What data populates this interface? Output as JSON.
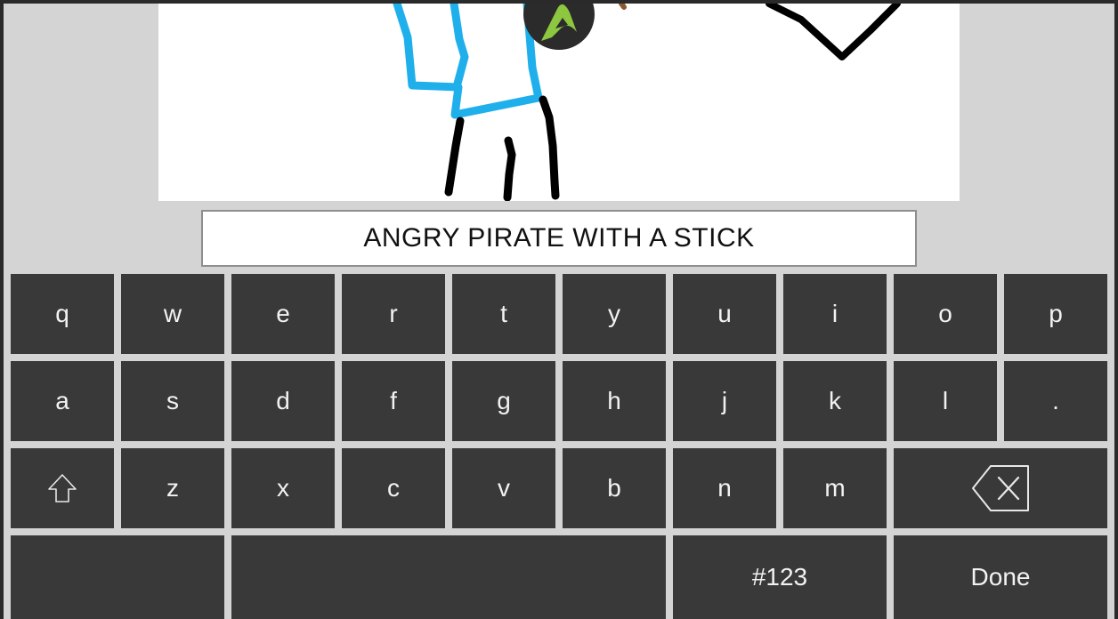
{
  "guess": {
    "text": "ANGRY PIRATE WITH A STICK"
  },
  "keyboard": {
    "row1": [
      "q",
      "w",
      "e",
      "r",
      "t",
      "y",
      "u",
      "i",
      "o",
      "p"
    ],
    "row2": [
      "a",
      "s",
      "d",
      "f",
      "g",
      "h",
      "j",
      "k",
      "l",
      "."
    ],
    "row3": [
      "z",
      "x",
      "c",
      "v",
      "b",
      "n",
      "m"
    ],
    "numbers_label": "#123",
    "done_label": "Done"
  },
  "colors": {
    "accent_green": "#8dc63f",
    "drawing_blue": "#1fb0ec",
    "key_bg": "#393939"
  },
  "icons": {
    "shift": "shift-arrow-icon",
    "backspace": "backspace-icon",
    "logo": "app-logo-icon"
  }
}
